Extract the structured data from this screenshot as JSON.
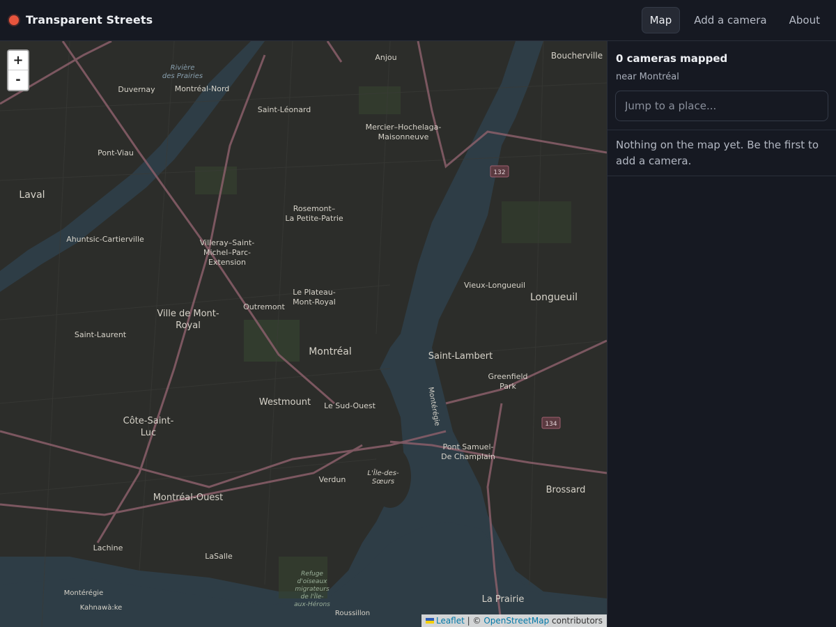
{
  "app": {
    "title": "Transparent Streets"
  },
  "nav": {
    "items": [
      {
        "label": "Map",
        "active": true
      },
      {
        "label": "Add a camera",
        "active": false
      },
      {
        "label": "About",
        "active": false
      }
    ]
  },
  "map": {
    "zoom_in_label": "+",
    "zoom_out_label": "-",
    "attribution": {
      "leaflet": "Leaflet",
      "separator": "| ©",
      "osm": "OpenStreetMap",
      "suffix": "contributors"
    },
    "places": [
      "Montréal",
      "Laval",
      "Longueuil",
      "Brossard",
      "Saint-Lambert",
      "La Prairie",
      "Verdun",
      "LaSalle",
      "Lachine",
      "Westmount",
      "Outremont",
      "Anjou",
      "Duvernay",
      "Montréal-Nord",
      "Saint-Léonard",
      "Pont-Viau",
      "Ahuntsic-Cartierville",
      "Saint-Laurent",
      "Rosemont–",
      "La Petite-Patrie",
      "Mercier–Hochelaga-",
      "Maisonneuve",
      "Villeray–Saint-",
      "Michel–Parc-",
      "Extension",
      "Le Plateau-",
      "Mont-Royal",
      "Ville de Mont-",
      "Royal",
      "Côte-Saint-",
      "Luc",
      "Le Sud-Ouest",
      "Montréal-Ouest",
      "L'Île-des-",
      "Sœurs",
      "Pont Samuel-",
      "De Champlain",
      "Greenfield",
      "Park",
      "Vieux-Longueuil",
      "Boucherville",
      "Montérégie",
      "Kahnawà:ke",
      "Rivière",
      "des Prairies",
      "Refuge",
      "d'oiseaux",
      "migrateurs",
      "de l'Île-",
      "aux-Hérons",
      "Roussillon",
      "132",
      "134"
    ]
  },
  "panel": {
    "count_label": "0 cameras mapped",
    "near_label": "near Montréal",
    "search_placeholder": "Jump to a place...",
    "empty_message": "Nothing on the map yet. Be the first to add a camera."
  },
  "colors": {
    "accent": "#e8553d",
    "background": "#161922",
    "water": "#2e3d46",
    "land": "#2c2d2a",
    "highway": "#8a5f6a"
  }
}
